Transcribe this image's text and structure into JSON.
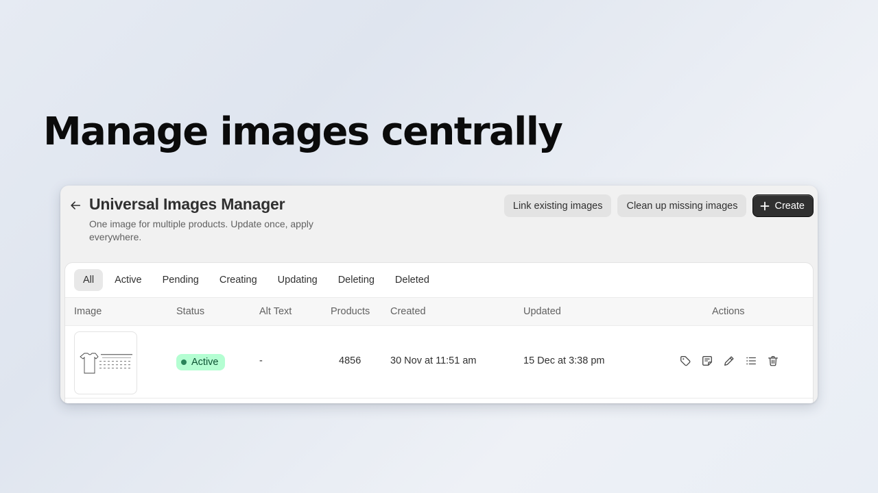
{
  "hero": {
    "title": "Manage images centrally"
  },
  "page": {
    "title": "Universal Images Manager",
    "subtitle": "One image for multiple products. Update once, apply everywhere."
  },
  "header_actions": {
    "link_existing": "Link existing images",
    "clean_up": "Clean up missing images",
    "create": "Create"
  },
  "tabs": [
    {
      "label": "All",
      "selected": true
    },
    {
      "label": "Active"
    },
    {
      "label": "Pending"
    },
    {
      "label": "Creating"
    },
    {
      "label": "Updating"
    },
    {
      "label": "Deleting"
    },
    {
      "label": "Deleted"
    }
  ],
  "table": {
    "columns": [
      "Image",
      "Status",
      "Alt Text",
      "Products",
      "Created",
      "Updated",
      "Actions"
    ],
    "rows": [
      {
        "status": "Active",
        "alt_text": "-",
        "products": "4856",
        "created": "30 Nov at 11:51 am",
        "updated": "15 Dec at 3:38 pm"
      }
    ],
    "row_actions": [
      "tag-icon",
      "note-icon",
      "pencil-icon",
      "list-icon",
      "trash-icon"
    ]
  },
  "colors": {
    "primary_button": "#303030",
    "badge_bg": "#b4fed2",
    "badge_text": "#0c5132",
    "badge_dot": "#29845a"
  }
}
